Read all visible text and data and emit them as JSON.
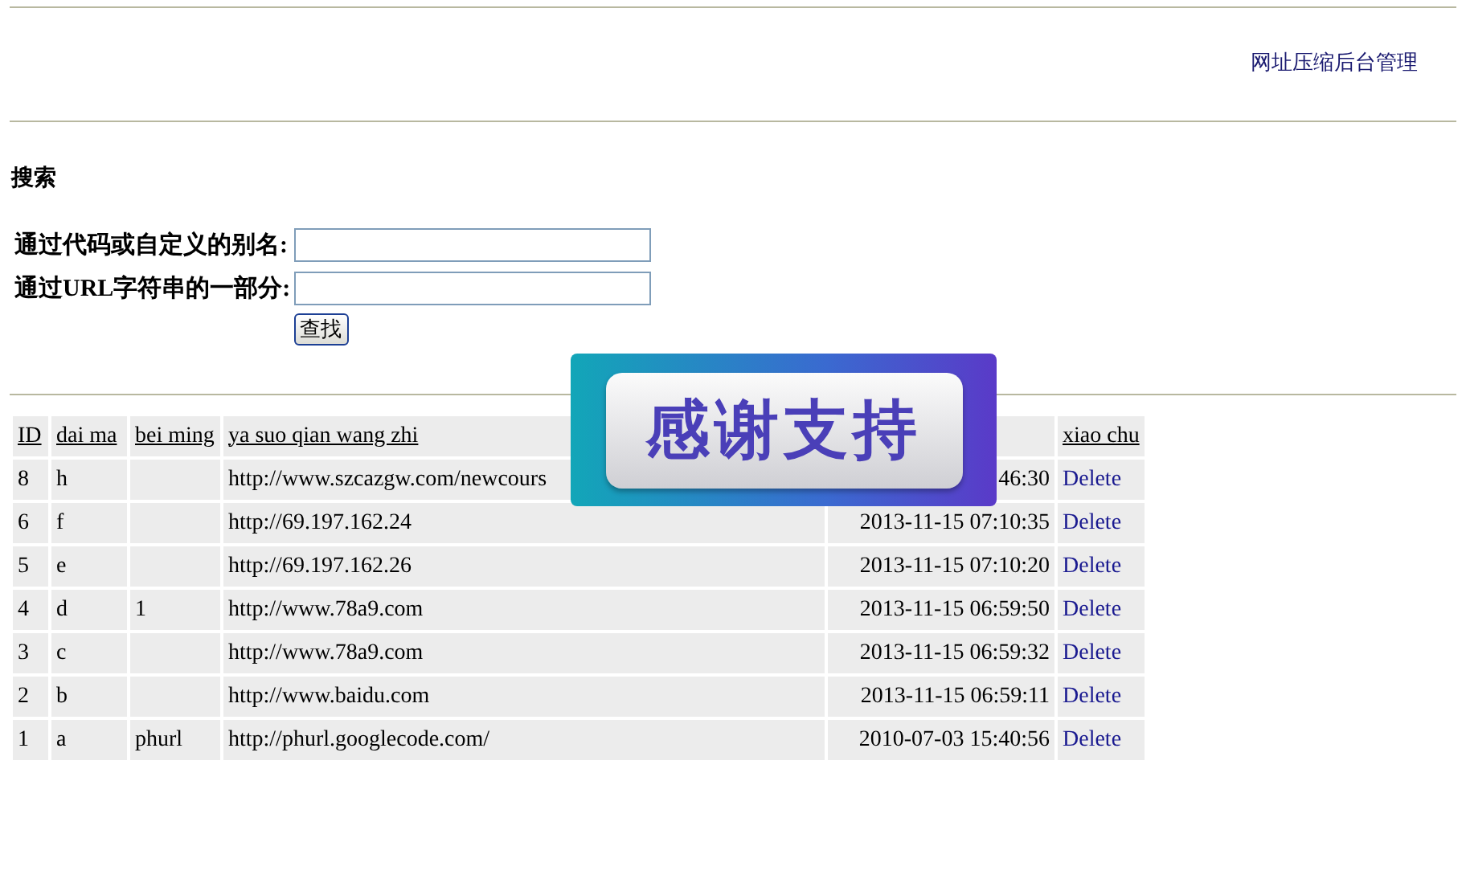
{
  "header": {
    "title_link": "网址压缩后台管理"
  },
  "search": {
    "heading": "搜索",
    "fields": [
      {
        "label": "通过代码或自定义的别名:"
      },
      {
        "label": "通过URL字符串的一部分:"
      }
    ],
    "button": "查找"
  },
  "table": {
    "columns": [
      {
        "label": "ID"
      },
      {
        "label": "dai ma"
      },
      {
        "label": "bei ming"
      },
      {
        "label": "ya suo qian wang zhi"
      },
      {},
      {
        "label": "xiao chu"
      }
    ],
    "rows": [
      {
        "id": "8",
        "code": "h",
        "alias": "",
        "url": "http://www.szcazgw.com/newcours",
        "time": "46:30",
        "action": "Delete"
      },
      {
        "id": "6",
        "code": "f",
        "alias": "",
        "url": "http://69.197.162.24",
        "time": "2013-11-15 07:10:35",
        "action": "Delete"
      },
      {
        "id": "5",
        "code": "e",
        "alias": "",
        "url": "http://69.197.162.26",
        "time": "2013-11-15 07:10:20",
        "action": "Delete"
      },
      {
        "id": "4",
        "code": "d",
        "alias": "1",
        "url": "http://www.78a9.com",
        "time": "2013-11-15 06:59:50",
        "action": "Delete"
      },
      {
        "id": "3",
        "code": "c",
        "alias": "",
        "url": "http://www.78a9.com",
        "time": "2013-11-15 06:59:32",
        "action": "Delete"
      },
      {
        "id": "2",
        "code": "b",
        "alias": "",
        "url": "http://www.baidu.com",
        "time": "2013-11-15 06:59:11",
        "action": "Delete"
      },
      {
        "id": "1",
        "code": "a",
        "alias": "phurl",
        "url": "http://phurl.googlecode.com/",
        "time": "2010-07-03 15:40:56",
        "action": "Delete"
      }
    ]
  },
  "overlay_banner": {
    "text": "感谢支持"
  }
}
